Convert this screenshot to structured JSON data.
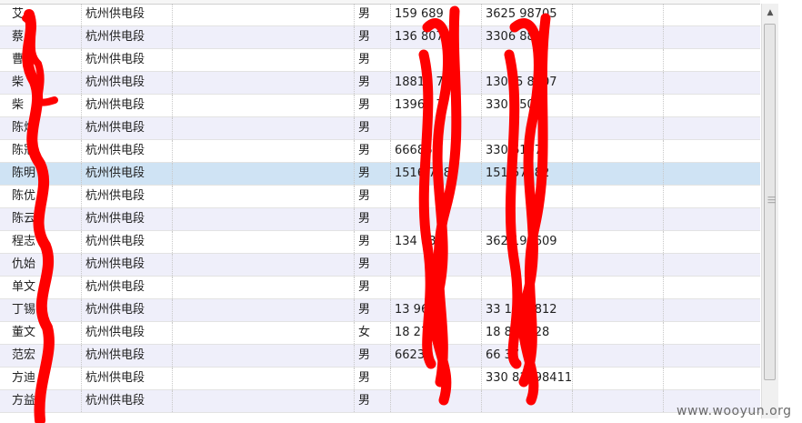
{
  "rows": [
    {
      "name": "艾",
      "org": "杭州供电段",
      "extra": "",
      "gender": "男",
      "phone": "159   689",
      "id": "3625   98705",
      "c6": "",
      "c7": ""
    },
    {
      "name": "蔡",
      "org": "杭州供电段",
      "extra": "",
      "gender": "男",
      "phone": "136      807",
      "id": "3306   8810",
      "c6": "",
      "c7": ""
    },
    {
      "name": "曹",
      "org": "杭州供电段",
      "extra": "",
      "gender": "男",
      "phone": "",
      "id": "",
      "c6": "",
      "c7": ""
    },
    {
      "name": "柴",
      "org": "杭州供电段",
      "extra": "",
      "gender": "男",
      "phone": "18814      7",
      "id": "13045   8707",
      "c6": "",
      "c7": ""
    },
    {
      "name": "柴",
      "org": "杭州供电段",
      "extra": "",
      "gender": "男",
      "phone": "13968      7",
      "id": "3301   508",
      "c6": "",
      "c7": ""
    },
    {
      "name": "陈烽",
      "org": "杭州供电段",
      "extra": "",
      "gender": "男",
      "phone": "",
      "id": "",
      "c6": "",
      "c7": ""
    },
    {
      "name": "陈冠",
      "org": "杭州供电段",
      "extra": "",
      "gender": "男",
      "phone": "66686",
      "id": "330   6107",
      "c6": "",
      "c7": ""
    },
    {
      "name": "陈明",
      "org": "杭州供电段",
      "extra": "",
      "gender": "男",
      "phone": "1516   7382",
      "id": "151   57382",
      "c6": "",
      "c7": ""
    },
    {
      "name": "陈优",
      "org": "杭州供电段",
      "extra": "",
      "gender": "男",
      "phone": "",
      "id": "",
      "c6": "",
      "c7": ""
    },
    {
      "name": "陈云",
      "org": "杭州供电段",
      "extra": "",
      "gender": "男",
      "phone": "",
      "id": "",
      "c6": "",
      "c7": ""
    },
    {
      "name": "程志",
      "org": "杭州供电段",
      "extra": "",
      "gender": "男",
      "phone": "134      836",
      "id": "362   198609",
      "c6": "",
      "c7": ""
    },
    {
      "name": "仇始",
      "org": "杭州供电段",
      "extra": "",
      "gender": "男",
      "phone": "",
      "id": "",
      "c6": "",
      "c7": ""
    },
    {
      "name": "单文",
      "org": "杭州供电段",
      "extra": "",
      "gender": "男",
      "phone": "",
      "id": "",
      "c6": "",
      "c7": ""
    },
    {
      "name": "丁锡",
      "org": "杭州供电段",
      "extra": "",
      "gender": "男",
      "phone": "13   9617",
      "id": "33   1197812",
      "c6": "",
      "c7": ""
    },
    {
      "name": "董文",
      "org": "杭州供电段",
      "extra": "",
      "gender": "女",
      "phone": "18   2728",
      "id": "18   852728",
      "c6": "",
      "c7": ""
    },
    {
      "name": "范宏",
      "org": "杭州供电段",
      "extra": "",
      "gender": "男",
      "phone": "66233",
      "id": "66   37",
      "c6": "",
      "c7": ""
    },
    {
      "name": "方迪",
      "org": "杭州供电段",
      "extra": "",
      "gender": "男",
      "phone": "",
      "id": "330   81198411",
      "c6": "",
      "c7": ""
    },
    {
      "name": "方益",
      "org": "杭州供电段",
      "extra": "",
      "gender": "男",
      "phone": "",
      "id": "",
      "c6": "",
      "c7": ""
    }
  ],
  "selected_row": 7,
  "scroll": {
    "position": 0.0
  },
  "colors": {
    "row_alt": "#efeffa",
    "row_selected": "#cfe3f4",
    "redaction": "#ff0000"
  },
  "watermark": "www.wooyun.org"
}
